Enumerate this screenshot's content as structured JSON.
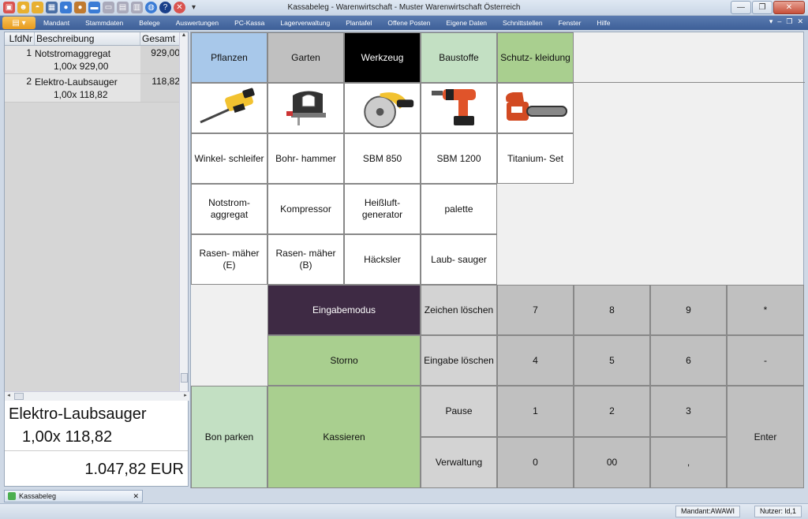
{
  "window": {
    "title": "Kassabeleg - Warenwirtschaft - Muster Warenwirtschaft Österreich"
  },
  "menu": [
    "Mandant",
    "Stammdaten",
    "Belege",
    "Auswertungen",
    "PC-Kassa",
    "Lagerverwaltung",
    "Plantafel",
    "Offene Posten",
    "Eigene Daten",
    "Schnittstellen",
    "Fenster",
    "Hilfe"
  ],
  "receipt": {
    "columns": {
      "nr": "LfdNr",
      "desc": "Beschreibung",
      "total": "Gesamt"
    },
    "rows": [
      {
        "nr": "1",
        "name": "Notstromaggregat",
        "qty": "1,00x 929,00",
        "total": "929,00"
      },
      {
        "nr": "2",
        "name": "Elektro-Laubsauger",
        "qty": "1,00x 118,82",
        "total": "118,82"
      }
    ],
    "selected_name": "Elektro-Laubsauger",
    "selected_qty": "1,00x 118,82",
    "grand_total": "1.047,82 EUR"
  },
  "categories": [
    {
      "label": "Pflanzen",
      "color": "#a8c8ea"
    },
    {
      "label": "Garten",
      "color": "#c0c0c0"
    },
    {
      "label": "Werkzeug",
      "color": "#000000"
    },
    {
      "label": "Baustoffe",
      "color": "#c3e0c3"
    },
    {
      "label": "Schutz- kleidung",
      "color": "#a9cf8f"
    }
  ],
  "product_images": [
    "reciprocating-saw-image",
    "jigsaw-image",
    "circular-saw-image",
    "cordless-drill-image",
    "chainsaw-image"
  ],
  "products": {
    "row1": [
      "Winkel- schleifer",
      "Bohr- hammer",
      "SBM 850",
      "SBM 1200",
      "Titanium- Set"
    ],
    "row2": [
      "Notstrom- aggregat",
      "Kompressor",
      "Heißluft- generator",
      "palette"
    ],
    "row3": [
      "Rasen- mäher (E)",
      "Rasen- mäher (B)",
      "Häcksler",
      "Laub- sauger"
    ]
  },
  "actions": {
    "eingabemodus": "Eingabemodus",
    "storno": "Storno",
    "bon_parken": "Bon parken",
    "kassieren": "Kassieren",
    "zeichen_loeschen": "Zeichen löschen",
    "eingabe_loeschen": "Eingabe löschen",
    "pause": "Pause",
    "verwaltung": "Verwaltung",
    "enter": "Enter"
  },
  "keypad": {
    "k7": "7",
    "k8": "8",
    "k9": "9",
    "kmul": "*",
    "k4": "4",
    "k5": "5",
    "k6": "6",
    "kminus": "-",
    "k1": "1",
    "k2": "2",
    "k3": "3",
    "k0": "0",
    "k00": "00",
    "kcomma": ","
  },
  "colors": {
    "eingabemodus": "#3e2a44",
    "green": "#a9cf8f",
    "light_green": "#c3e0c3",
    "key_gray": "#c0c0c0"
  },
  "taskbar": {
    "tab_label": "Kassabeleg"
  },
  "status": {
    "mandant": "Mandant:AWAWI",
    "nutzer": "Nutzer: ld,1"
  }
}
